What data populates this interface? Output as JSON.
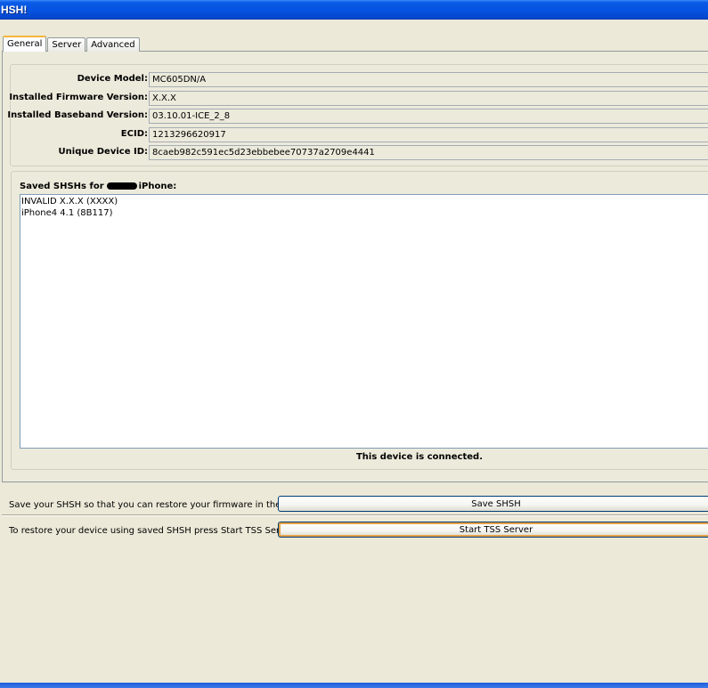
{
  "window": {
    "title": "HSH!"
  },
  "tabs": [
    {
      "label": "General",
      "active": true
    },
    {
      "label": "Server",
      "active": false
    },
    {
      "label": "Advanced",
      "active": false
    }
  ],
  "device_info": {
    "model": {
      "label": "Device Model:",
      "value": "MC605DN/A"
    },
    "firmware": {
      "label": "Installed Firmware Version:",
      "value": "X.X.X"
    },
    "baseband": {
      "label": "Installed Baseband Version:",
      "value": "03.10.01-ICE_2_8"
    },
    "ecid": {
      "label": "ECID:",
      "value": "1213296620917"
    },
    "udid": {
      "label": "Unique Device ID:",
      "value": "8caeb982c591ec5d23ebbebee70737a2709e4441"
    }
  },
  "saved_shsh": {
    "title_prefix": "Saved SHSHs for",
    "title_suffix": "iPhone:",
    "items": [
      "INVALID X.X.X (XXXX)",
      "iPhone4 4.1 (8B117)"
    ]
  },
  "status": "This device is connected.",
  "actions": {
    "save": {
      "description": "Save your SHSH so that you can restore your firmware in the future.",
      "button": "Save SHSH"
    },
    "tss": {
      "description": "To restore your device using saved SHSH press Start TSS Server",
      "button": "Start TSS Server"
    }
  },
  "colors": {
    "titlebar": "#0553e0",
    "active_tab_accent": "#f7b53c",
    "window_bg": "#ece9d8"
  }
}
